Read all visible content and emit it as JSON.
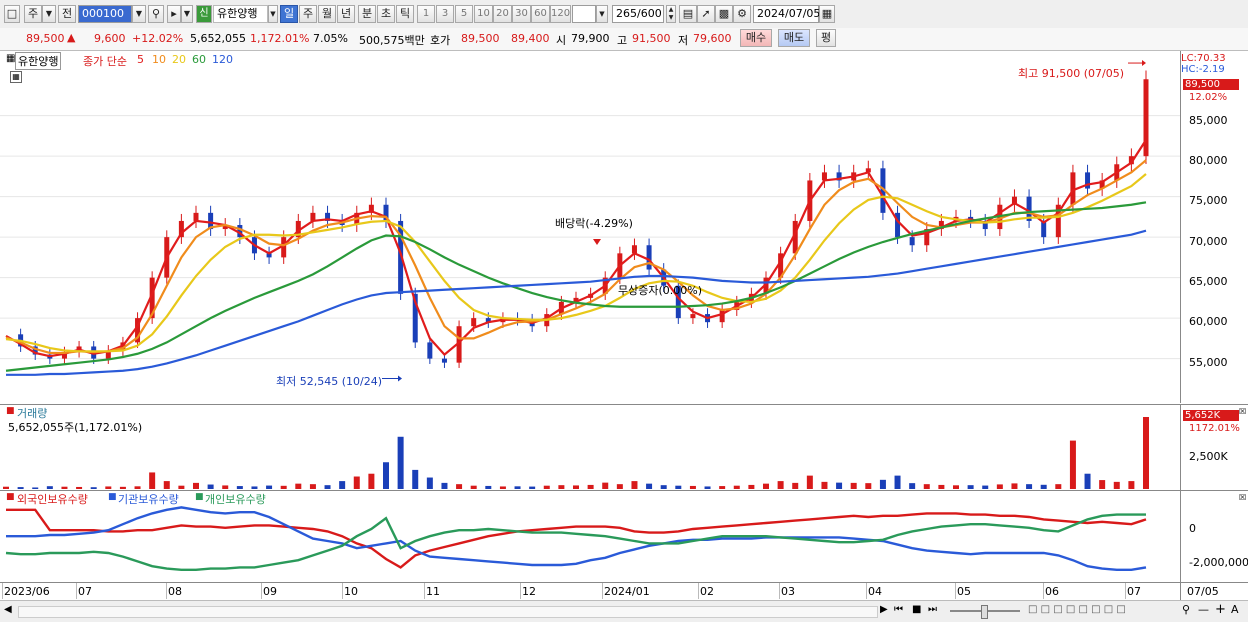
{
  "toolbar": {
    "period_small": "주",
    "prev_label": "전",
    "code": "000100",
    "badge": "신",
    "stock_name": "유한양행",
    "tabs": [
      "일",
      "주",
      "월",
      "년",
      "분",
      "초",
      "틱"
    ],
    "active_tab": "일",
    "num_buttons": [
      "1",
      "3",
      "5",
      "10",
      "20",
      "30",
      "60",
      "120"
    ],
    "count": "265",
    "count_total": "/600",
    "date": "2024/07/05"
  },
  "quote": {
    "price": "89,500",
    "change": "9,600",
    "change_pct": "+12.02%",
    "volume": "5,652,055",
    "volume_pct": "1,172.01%",
    "turnover_pct": "7.05%",
    "amount": "500,575백만",
    "bid_label": "호가",
    "bid1": "89,500",
    "bid2": "89,400",
    "open_label": "시",
    "open": "79,900",
    "high_label": "고",
    "high": "91,500",
    "low_label": "저",
    "low": "79,600",
    "buy_button": "매수",
    "sell_button": "매도",
    "eval_button": "평"
  },
  "price_chart": {
    "stock_label": "유한양행",
    "legend_prefix": "종가 단순",
    "ma_periods": [
      "5",
      "10",
      "20",
      "60",
      "120"
    ],
    "ma_colors": [
      "#e11c1c",
      "#f08c1c",
      "#e8c81a",
      "#2a9a3a",
      "#2a5ad8"
    ],
    "lc": "LC:70.33",
    "hc": "HC:-2.19",
    "last_price": "89,500",
    "last_pct": "12.02%",
    "y_ticks": [
      "85,000",
      "80,000",
      "75,000",
      "70,000",
      "65,000",
      "60,000",
      "55,000"
    ],
    "high_annot": "최고 91,500 (07/05)",
    "low_annot": "최저 52,545 (10/24)",
    "dividend_annot": "배당락(-4.29%)",
    "bonus_annot": "무상증자(0.00%)"
  },
  "volume_chart": {
    "title": "거래량",
    "subtitle": "5,652,055주(1,172.01%)",
    "last_badge": "5,652K",
    "last_pct": "1172.01%",
    "y_tick": "2,500K"
  },
  "holding_chart": {
    "legend": [
      "외국인보유수량",
      "기관보유수량",
      "개인보유수량"
    ],
    "legend_colors": [
      "#d81a1a",
      "#2a5ad8",
      "#2a9a5a"
    ],
    "y_ticks": [
      "0",
      "-2,000,000"
    ]
  },
  "x_axis": {
    "labels": [
      "2023/06",
      "07",
      "08",
      "09",
      "10",
      "11",
      "12",
      "2024/01",
      "02",
      "03",
      "04",
      "05",
      "06",
      "07"
    ],
    "right_label": "07/05"
  },
  "chart_data": [
    {
      "type": "line",
      "title": "",
      "dates_note": "",
      "series": [
        {
          "name": "종가",
          "values": [
            58000,
            56500,
            55500,
            55000,
            55800,
            56500,
            55000,
            56000,
            57000,
            60000,
            65000,
            70000,
            72000,
            73000,
            71000,
            71500,
            70000,
            68000,
            67500,
            70000,
            72000,
            73000,
            72000,
            71500,
            73000,
            74000,
            72000,
            63000,
            57000,
            55000,
            54500,
            59000,
            60000,
            59500,
            60000,
            59800,
            59000,
            60500,
            62000,
            62500,
            63000,
            65000,
            68000,
            69000,
            66000,
            64000,
            60000,
            60500,
            59500,
            61000,
            62000,
            63000,
            65000,
            68000,
            72000,
            77000,
            78000,
            77000,
            78000,
            78500,
            73000,
            70000,
            69000,
            71000,
            72000,
            72500,
            72000,
            71000,
            74000,
            75000,
            72000,
            70000,
            74000,
            78000,
            76000,
            77000,
            79000,
            80000,
            89500
          ]
        },
        {
          "name": "5",
          "values": [
            57800,
            56800,
            55700,
            55300,
            55600,
            56100,
            55600,
            55900,
            56600,
            59000,
            63000,
            67500,
            70500,
            72000,
            71800,
            71500,
            70500,
            69000,
            68000,
            69000,
            70800,
            72000,
            72200,
            72000,
            72800,
            73200,
            72500,
            68000,
            62000,
            57500,
            55500,
            57000,
            58800,
            59500,
            59800,
            59800,
            59400,
            60000,
            61200,
            62000,
            62800,
            64000,
            66500,
            68000,
            67200,
            65000,
            62500,
            60800,
            60000,
            60500,
            61500,
            62500,
            64200,
            67000,
            70500,
            74500,
            77000,
            77200,
            77500,
            78000,
            75000,
            72000,
            70200,
            70500,
            71200,
            72000,
            72200,
            71800,
            73000,
            74200,
            73200,
            71800,
            73000,
            75800,
            76500,
            76800,
            78000,
            79200,
            82000
          ]
        },
        {
          "name": "10",
          "values": [
            57600,
            57000,
            56200,
            55700,
            55700,
            55900,
            55800,
            55900,
            56300,
            57600,
            60500,
            64000,
            67500,
            70000,
            71200,
            71500,
            71000,
            70200,
            69200,
            69000,
            69800,
            70800,
            71500,
            71800,
            72300,
            72600,
            72500,
            70200,
            66500,
            62500,
            59000,
            57500,
            57500,
            58200,
            59000,
            59500,
            59600,
            59800,
            60500,
            61200,
            62000,
            63000,
            64800,
            66300,
            66800,
            66000,
            64500,
            62800,
            61500,
            61000,
            61200,
            61800,
            63000,
            65000,
            67800,
            71000,
            74000,
            75800,
            76800,
            77200,
            76000,
            74200,
            72500,
            71500,
            71200,
            71500,
            71800,
            71800,
            72300,
            73000,
            73000,
            72500,
            72700,
            74000,
            75200,
            76000,
            77000,
            78000,
            79500
          ]
        },
        {
          "name": "20",
          "values": [
            57400,
            57200,
            56800,
            56300,
            56000,
            55900,
            55900,
            55900,
            56000,
            56600,
            58000,
            60200,
            62800,
            65200,
            67200,
            68800,
            69800,
            70300,
            70300,
            70200,
            70300,
            70600,
            70900,
            71200,
            71600,
            71900,
            72000,
            71300,
            69400,
            67000,
            64600,
            62500,
            61000,
            60300,
            60000,
            59900,
            59800,
            59800,
            60000,
            60400,
            60900,
            61500,
            62500,
            63600,
            64300,
            64600,
            64500,
            64000,
            63200,
            62500,
            62100,
            62000,
            62400,
            63400,
            65000,
            67200,
            69600,
            71700,
            73400,
            74600,
            75000,
            74800,
            74000,
            73200,
            72500,
            72200,
            72000,
            71800,
            71900,
            72200,
            72400,
            72400,
            72500,
            73000,
            73700,
            74500,
            75400,
            76300,
            77800
          ]
        },
        {
          "name": "60",
          "values": [
            53500,
            53700,
            53900,
            54100,
            54300,
            54500,
            54700,
            54900,
            55200,
            55600,
            56200,
            57000,
            58000,
            59000,
            60000,
            60900,
            61700,
            62500,
            63200,
            63900,
            64600,
            65400,
            66400,
            67500,
            68600,
            69600,
            70200,
            70100,
            69400,
            68500,
            67500,
            66600,
            65800,
            65000,
            64300,
            63700,
            63100,
            62600,
            62200,
            61900,
            61700,
            61500,
            61400,
            61400,
            61400,
            61400,
            61400,
            61500,
            61600,
            61800,
            62100,
            62500,
            63100,
            63800,
            64600,
            65500,
            66400,
            67300,
            68100,
            68800,
            69400,
            69900,
            70400,
            70800,
            71200,
            71600,
            72000,
            72300,
            72600,
            72900,
            73100,
            73200,
            73300,
            73400,
            73500,
            73600,
            73800,
            74000,
            74300
          ]
        },
        {
          "name": "120",
          "values": [
            53000,
            53000,
            53000,
            53100,
            53100,
            53200,
            53300,
            53400,
            53500,
            53700,
            54000,
            54400,
            54900,
            55400,
            56000,
            56600,
            57200,
            57800,
            58400,
            59000,
            59600,
            60300,
            61000,
            61700,
            62300,
            62800,
            63100,
            63200,
            63300,
            63400,
            63500,
            63600,
            63700,
            63800,
            63900,
            64000,
            64100,
            64200,
            64300,
            64400,
            64500,
            64700,
            64900,
            65100,
            65200,
            65200,
            65100,
            65000,
            64800,
            64600,
            64500,
            64400,
            64400,
            64500,
            64600,
            64700,
            64800,
            64900,
            65000,
            65100,
            65300,
            65500,
            65800,
            66100,
            66400,
            66700,
            67000,
            67300,
            67600,
            67900,
            68200,
            68500,
            68800,
            69100,
            69400,
            69700,
            70000,
            70300,
            70800
          ]
        }
      ]
    },
    {
      "type": "bar",
      "title": "거래량",
      "max_value": 5652055,
      "values": [
        180000,
        150000,
        120000,
        220000,
        180000,
        160000,
        140000,
        200000,
        170000,
        210000,
        1300000,
        620000,
        260000,
        480000,
        350000,
        280000,
        230000,
        200000,
        270000,
        250000,
        420000,
        380000,
        300000,
        620000,
        980000,
        1200000,
        2100000,
        4100000,
        1500000,
        900000,
        480000,
        380000,
        260000,
        240000,
        200000,
        210000,
        190000,
        260000,
        300000,
        280000,
        320000,
        500000,
        380000,
        620000,
        420000,
        300000,
        260000,
        240000,
        200000,
        230000,
        260000,
        320000,
        420000,
        620000,
        480000,
        1050000,
        560000,
        500000,
        480000,
        460000,
        720000,
        1050000,
        460000,
        380000,
        320000,
        290000,
        300000,
        270000,
        360000,
        440000,
        380000,
        330000,
        380000,
        3800000,
        1200000,
        700000,
        560000,
        620000,
        5652055
      ],
      "colors_note": "red=up, blue=down"
    },
    {
      "type": "line",
      "title": "",
      "series": [
        {
          "name": "외국인보유수량",
          "values": [
            1.6,
            1.6,
            1.6,
            -0.1,
            -0.1,
            -0.1,
            -0.1,
            -0.2,
            -0.2,
            -0.1,
            -0.1,
            0.1,
            0.3,
            0.2,
            0.2,
            0.1,
            0.2,
            0.3,
            0.3,
            0.2,
            0.1,
            0.0,
            -0.2,
            -0.6,
            -1.2,
            -1.6,
            -2.5,
            -3.2,
            -2.2,
            -1.8,
            -1.5,
            -1.2,
            -0.9,
            -0.6,
            -0.4,
            -0.2,
            -0.1,
            0.0,
            0.1,
            0.2,
            0.2,
            0.2,
            0.1,
            -0.2,
            -0.3,
            -0.3,
            -0.2,
            0.0,
            0.1,
            0.2,
            0.3,
            0.4,
            0.5,
            0.6,
            0.7,
            0.8,
            0.9,
            1.0,
            1.1,
            1.0,
            1.1,
            1.1,
            1.2,
            1.3,
            1.3,
            1.3,
            1.2,
            1.2,
            1.1,
            1.1,
            1.0,
            0.8,
            0.7,
            0.6,
            0.5,
            0.6,
            0.5,
            0.4,
            0.8
          ]
        },
        {
          "name": "기관보유수량",
          "values": [
            -0.6,
            -0.6,
            -0.6,
            -0.5,
            -0.5,
            -0.4,
            -0.3,
            -0.1,
            0.4,
            0.9,
            1.3,
            1.6,
            1.8,
            1.6,
            1.4,
            1.3,
            1.4,
            1.4,
            1.0,
            0.4,
            -0.2,
            -0.8,
            -1.0,
            -1.2,
            -1.6,
            -1.4,
            -1.2,
            -1.0,
            -1.8,
            -2.3,
            -2.4,
            -2.5,
            -2.6,
            -2.7,
            -2.8,
            -2.9,
            -3.0,
            -3.0,
            -3.0,
            -2.9,
            -2.6,
            -2.4,
            -2.0,
            -1.7,
            -1.4,
            -1.2,
            -1.0,
            -0.9,
            -0.9,
            -0.8,
            -0.8,
            -0.8,
            -0.7,
            -0.7,
            -0.7,
            -0.7,
            -0.7,
            -0.7,
            -0.8,
            -0.9,
            -1.0,
            -1.3,
            -1.6,
            -1.8,
            -1.9,
            -2.0,
            -2.1,
            -2.0,
            -2.0,
            -2.0,
            -2.0,
            -2.0,
            -2.2,
            -2.6,
            -3.1,
            -3.3,
            -3.4,
            -3.4,
            -3.2
          ]
        },
        {
          "name": "개인보유수량",
          "values": [
            -2.0,
            -2.1,
            -2.1,
            -2.0,
            -2.0,
            -2.0,
            -1.9,
            -2.0,
            -2.3,
            -2.7,
            -3.1,
            -3.3,
            -3.4,
            -3.4,
            -3.3,
            -3.3,
            -3.2,
            -3.2,
            -3.0,
            -2.8,
            -2.6,
            -2.2,
            -1.8,
            -1.4,
            -0.6,
            0.0,
            0.9,
            -1.6,
            -1.0,
            -0.6,
            -0.3,
            -0.1,
            -0.1,
            0.0,
            -0.1,
            -0.2,
            -0.3,
            -0.3,
            -0.3,
            -0.4,
            -0.5,
            -0.6,
            -0.8,
            -1.0,
            -1.2,
            -1.2,
            -1.2,
            -1.0,
            -0.8,
            -0.6,
            -0.6,
            -0.6,
            -0.6,
            -0.7,
            -0.8,
            -0.9,
            -1.0,
            -1.1,
            -1.1,
            -1.0,
            -0.9,
            -0.5,
            -0.2,
            0.0,
            0.2,
            0.3,
            0.4,
            0.4,
            0.3,
            0.2,
            0.1,
            -0.1,
            -0.2,
            0.3,
            0.8,
            1.1,
            1.2,
            1.2,
            1.2
          ]
        }
      ]
    }
  ]
}
